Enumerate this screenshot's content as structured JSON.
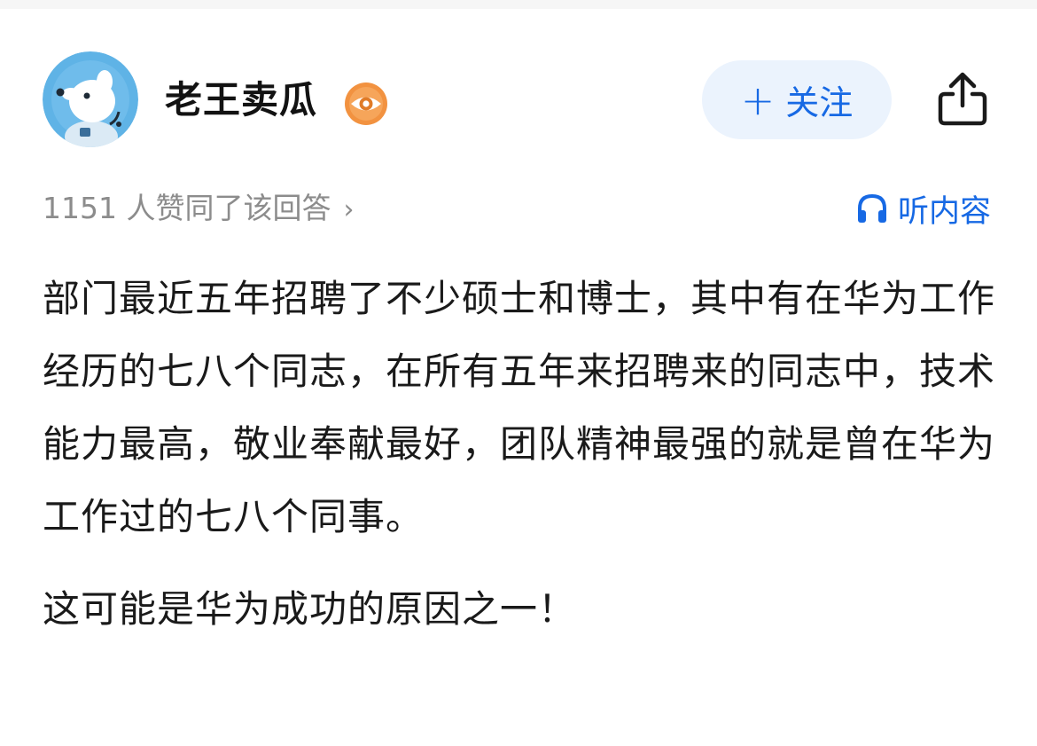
{
  "author": {
    "name": "老王卖瓜"
  },
  "follow_button": {
    "plus": "+",
    "label": "关注"
  },
  "meta": {
    "agree_text": "1151 人赞同了该回答",
    "chevron": "›",
    "listen_label": "听内容"
  },
  "answer": {
    "paragraphs": [
      "部门最近五年招聘了不少硕士和博士，其中有在华为工作经历的七八个同志，在所有五年来招聘来的同志中，技术能力最高，敬业奉献最好，团队精神最强的就是曾在华为工作过的七八个同事。",
      "这可能是华为成功的原因之一！"
    ]
  },
  "icons": {
    "avatar": "cartoon-dog-avatar",
    "badge": "eye-verified-badge",
    "share": "share-icon",
    "headphone": "headphone-icon"
  },
  "colors": {
    "accent_blue": "#1769e4",
    "follow_bg": "#ebf3fd",
    "badge_orange": "#f29240",
    "meta_gray": "#8c8c8c",
    "text": "#1a1a1a",
    "avatar_bg": "#58aee2"
  }
}
